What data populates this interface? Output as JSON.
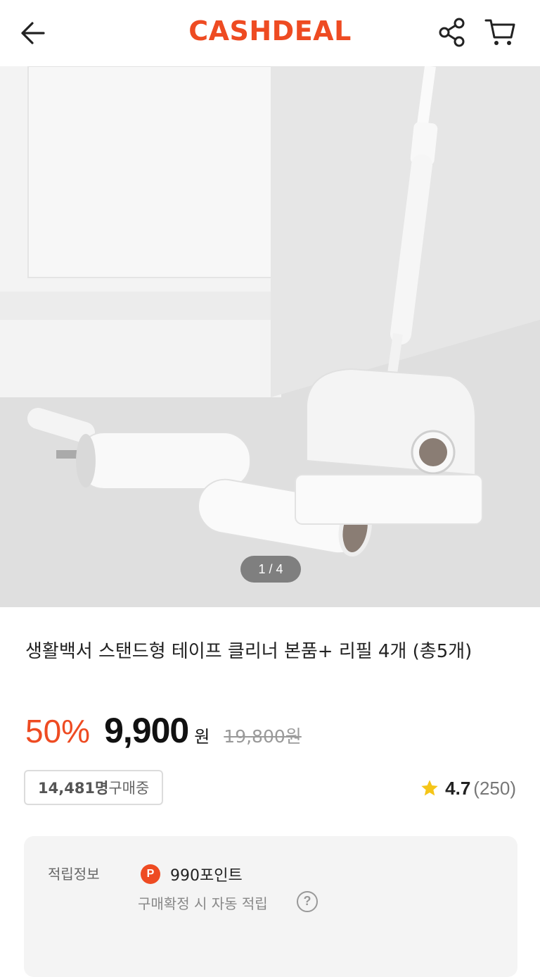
{
  "header": {
    "logo": "CASHDEAL",
    "brand_color": "#ee4b22",
    "back_icon": "arrow-left-icon",
    "share_icon": "share-icon",
    "cart_icon": "cart-icon"
  },
  "gallery": {
    "pager": "1 / 4",
    "image": "product-photo-tape-cleaner"
  },
  "product": {
    "title": "생활백서 스탠드형 테이프 클리너 본품+ 리필 4개 (총5개)",
    "discount": "50%",
    "price": "9,900",
    "currency": "원",
    "original_price": "19,800원",
    "buyers_count": "14,481명",
    "buyers_label": " 구매중",
    "rating": "4.7",
    "review_count": "(250)",
    "star_icon": "star-icon",
    "star_color": "#f5c518"
  },
  "points": {
    "label": "적립정보",
    "badge": "P",
    "value": "990포인트",
    "note": "구매확정 시 자동 적립",
    "help_icon": "question-circle-icon"
  }
}
